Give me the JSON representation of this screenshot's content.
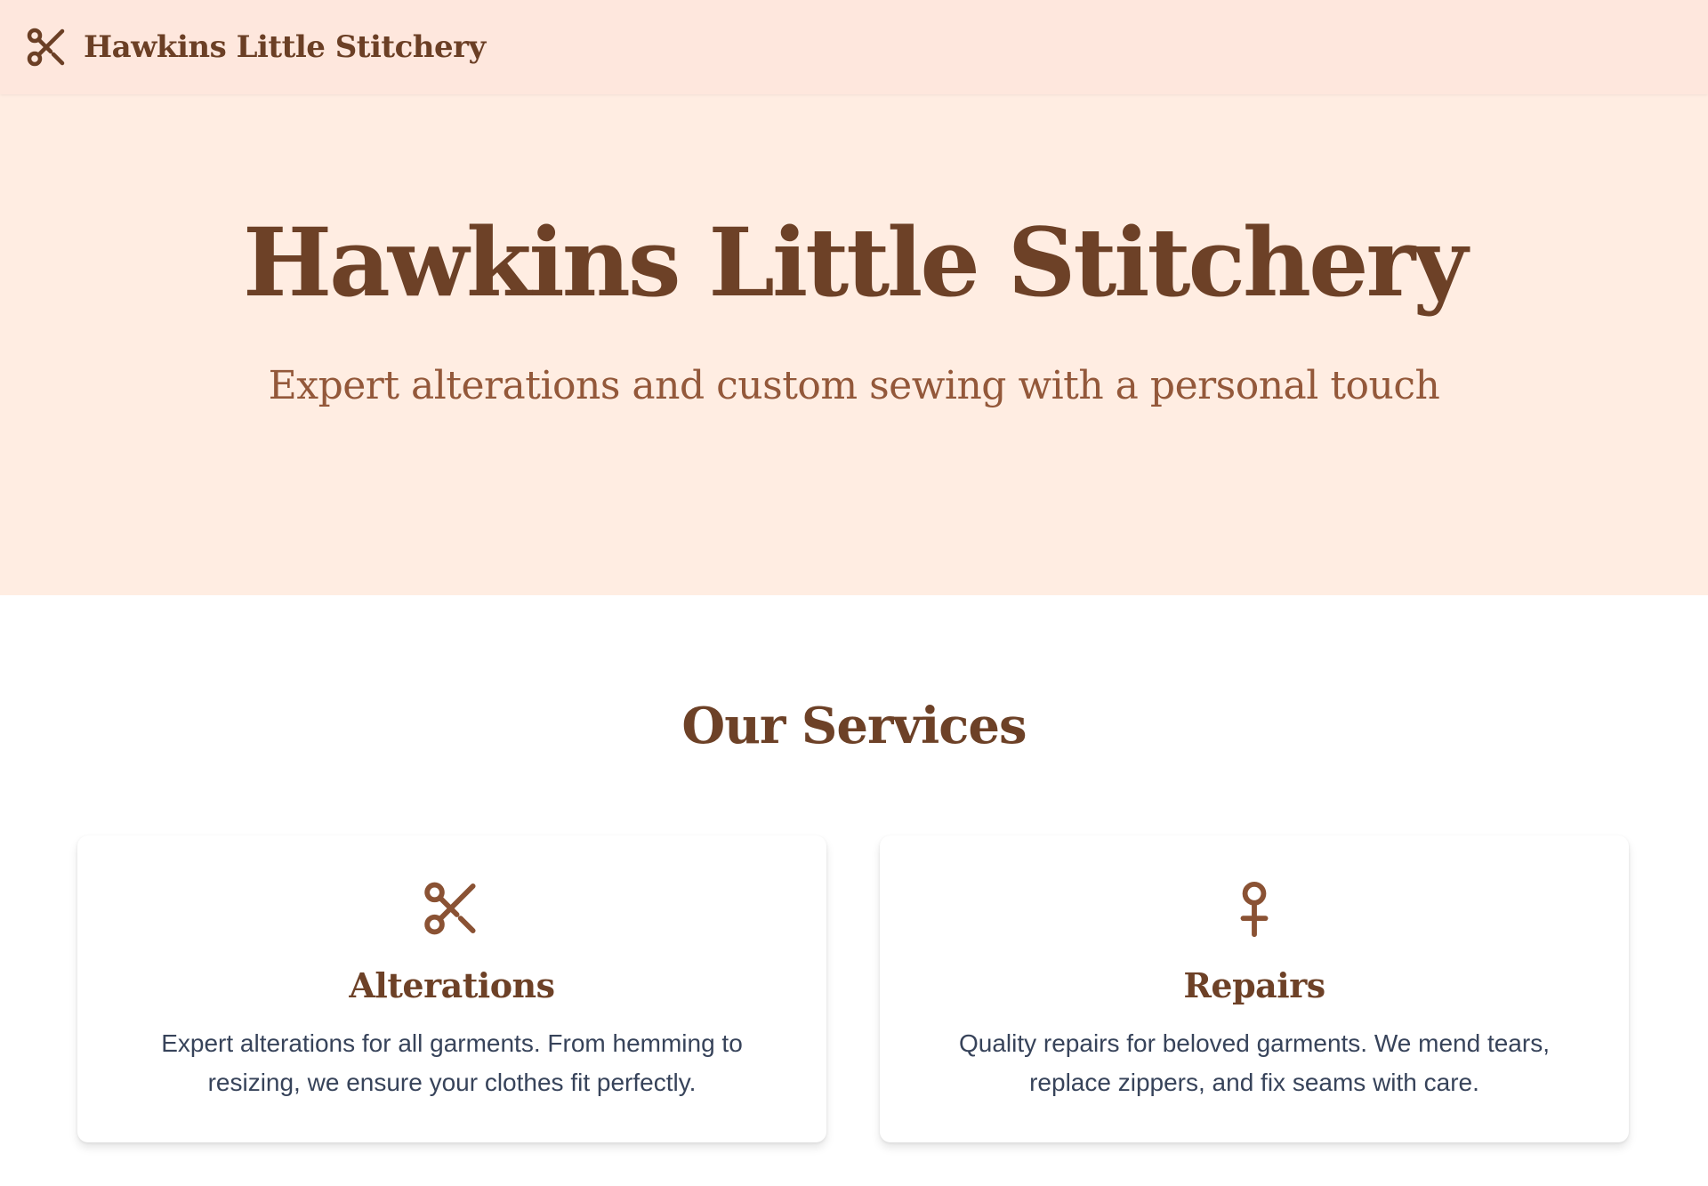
{
  "colors": {
    "brand_brown": "#6d4127",
    "accent_brown": "#93583a",
    "header_bg": "#fee7dd",
    "hero_bg": "#ffede2",
    "body_text": "#37435a"
  },
  "header": {
    "logo_icon": "scissors-icon",
    "brand_name": "Hawkins Little Stitchery"
  },
  "hero": {
    "title": "Hawkins Little Stitchery",
    "subtitle": "Expert alterations and custom sewing with a personal touch"
  },
  "services": {
    "heading": "Our Services",
    "cards": [
      {
        "icon": "scissors-icon",
        "title": "Alterations",
        "description": "Expert alterations for all garments. From hemming to resizing, we ensure your clothes fit perfectly."
      },
      {
        "icon": "needle-icon",
        "title": "Repairs",
        "description": "Quality repairs for beloved garments. We mend tears, replace zippers, and fix seams with care."
      }
    ]
  }
}
